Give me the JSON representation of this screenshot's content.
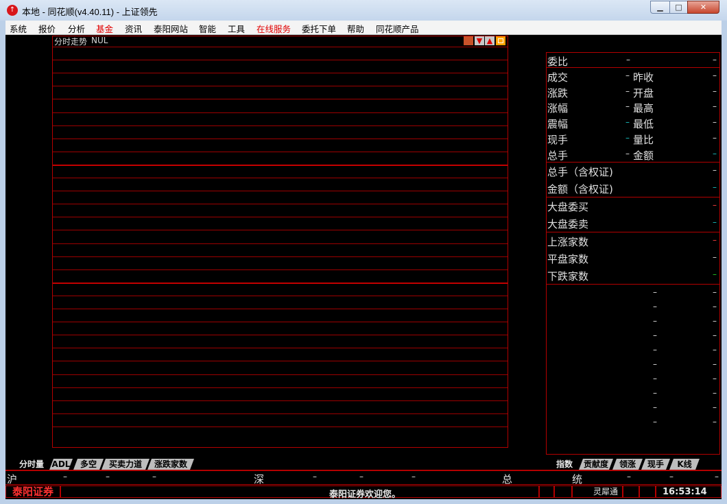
{
  "window": {
    "title": "本地 - 同花顺(v4.40.11) - 上证领先",
    "minimize_label": "▁",
    "maximize_label": "□",
    "close_label": "✕"
  },
  "menu": [
    "系统",
    "报价",
    "分析",
    "基金",
    "资讯",
    "泰阳网站",
    "智能",
    "工具",
    "在线服务",
    "委托下单",
    "帮助",
    "同花顺产品"
  ],
  "menu_highlight": [
    "基金",
    "在线服务"
  ],
  "chart": {
    "title": "分时走势",
    "stock": "NUL",
    "tool_up": "▲",
    "tool_down": "▼"
  },
  "right_panel": {
    "weibi": "委比",
    "pairs": [
      {
        "left": "成交",
        "right": "昨收"
      },
      {
        "left": "涨跌",
        "right": "开盘"
      },
      {
        "left": "涨幅",
        "right": "最高"
      },
      {
        "left": "震幅",
        "right": "最低"
      },
      {
        "left": "现手",
        "right": "量比"
      },
      {
        "left": "总手",
        "right": "金额"
      }
    ],
    "rows": [
      "总手（含权证)",
      "金额（含权证)",
      "大盘委买",
      "大盘委卖",
      "上涨家数",
      "平盘家数",
      "下跌家数"
    ],
    "dash": "–"
  },
  "left_tabs": [
    "分时量",
    "ADL",
    "多空",
    "买卖力道",
    "涨跌家数"
  ],
  "right_tabs": [
    "指数",
    "贡献度",
    "领涨",
    "现手",
    "K线"
  ],
  "index_bar": {
    "sh": "沪",
    "sz": "深",
    "total": "总",
    "stat": "统"
  },
  "status": {
    "brand": "泰阳证券",
    "welcome": "泰阳证券欢迎您。",
    "lingxi": "灵犀通",
    "time": "16:53:14"
  }
}
